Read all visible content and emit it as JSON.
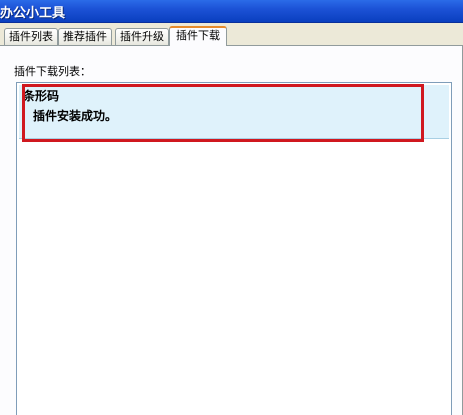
{
  "window": {
    "title": "办公小工具"
  },
  "tabs": [
    {
      "label": "插件列表",
      "active": false
    },
    {
      "label": "推荐插件",
      "active": false
    },
    {
      "label": "插件升级",
      "active": false
    },
    {
      "label": "插件下载",
      "active": true
    }
  ],
  "download": {
    "list_label": "插件下载列表：",
    "items": [
      {
        "name": "条形码",
        "status": "插件安装成功。"
      }
    ]
  },
  "colors": {
    "title_bar": "#1c52d6",
    "active_tab_accent": "#e68b2c",
    "selected_item_bg": "#dff2fb",
    "annotation_box": "#d0181f"
  }
}
